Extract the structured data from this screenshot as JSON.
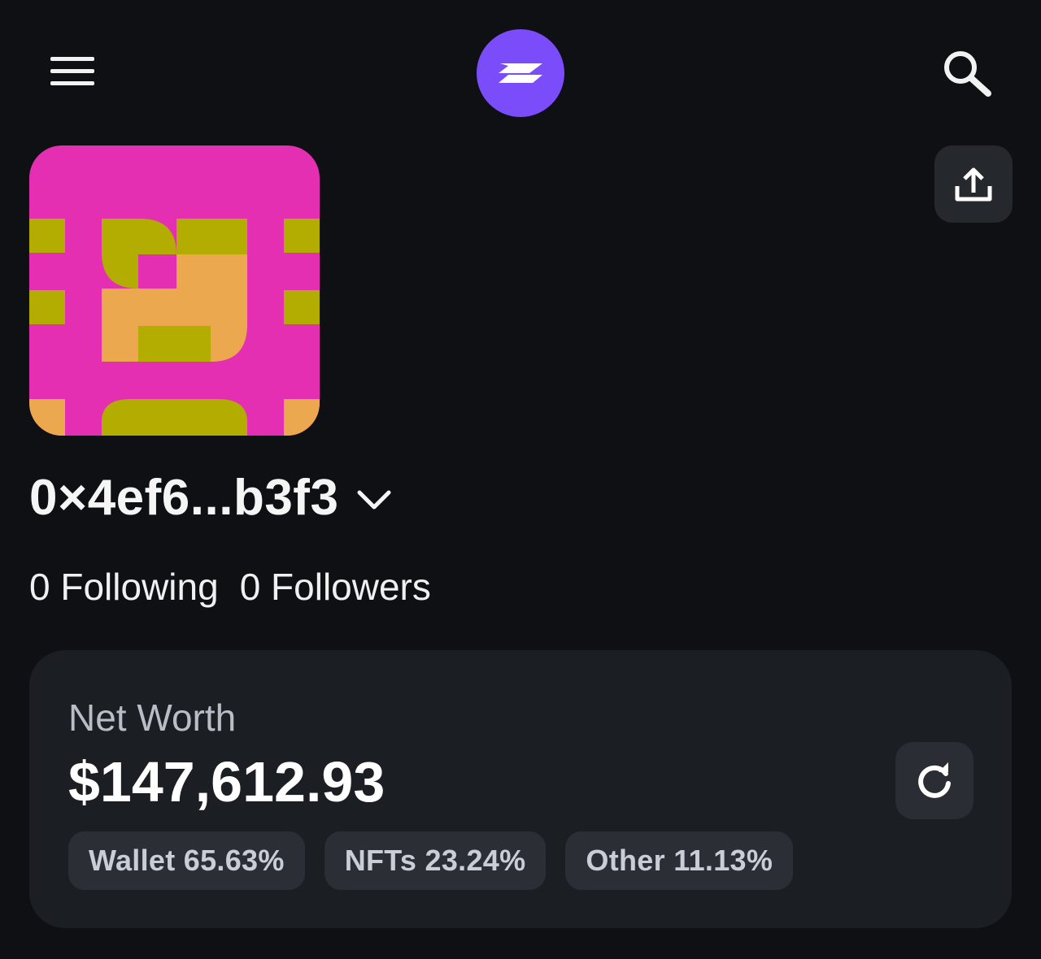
{
  "header": {
    "menu_icon": "hamburger-menu-icon",
    "logo_icon": "zerion-logo",
    "search_icon": "search-icon",
    "logo_color": "#7b4dfa"
  },
  "profile": {
    "avatar_colors": {
      "background": "#e42fb2",
      "olive": "#b2ad00",
      "orange": "#eba84e"
    },
    "address": "0×4ef6...b3f3",
    "address_dropdown_icon": "chevron-down-icon",
    "share_icon": "share-upload-icon",
    "following_label": "0 Following",
    "followers_label": "0 Followers"
  },
  "net_worth": {
    "label": "Net Worth",
    "value": "$147,612.93",
    "refresh_icon": "refresh-icon",
    "breakdown": [
      {
        "label": "Wallet 65.63%"
      },
      {
        "label": "NFTs 23.24%"
      },
      {
        "label": "Other 11.13%"
      }
    ]
  }
}
